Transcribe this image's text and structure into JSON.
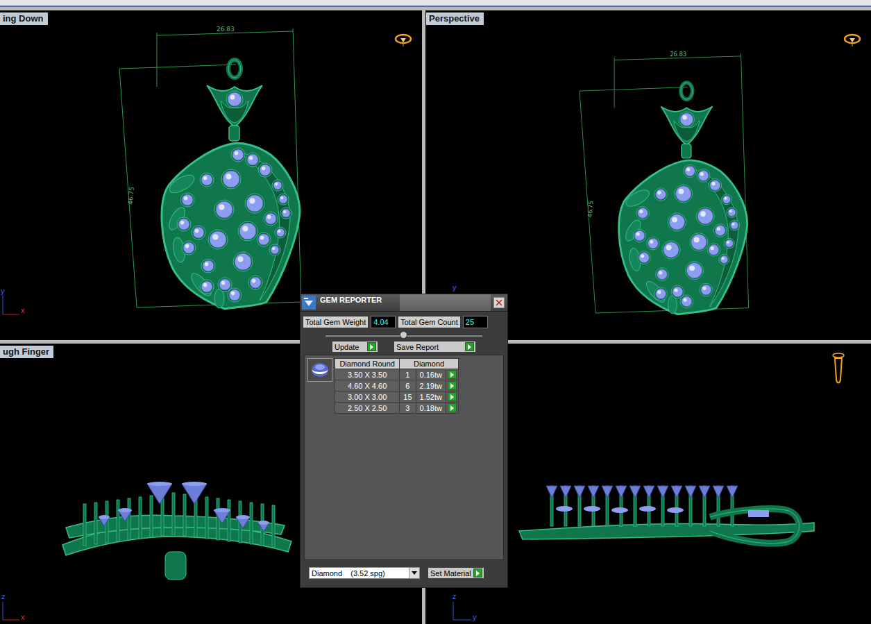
{
  "viewports": [
    {
      "label": "ing Down",
      "dimension_width": "26.83",
      "dimension_height": "46.75",
      "axis_labels": [
        "y",
        "x"
      ]
    },
    {
      "label": "Perspective",
      "dimension_width": "26.83",
      "dimension_height": "46.75",
      "axis_labels": [
        "y"
      ]
    },
    {
      "label": "ugh Finger",
      "axis_labels": [
        "z",
        "x"
      ]
    },
    {
      "label": "",
      "axis_labels": [
        "z",
        "y"
      ]
    }
  ],
  "gem_reporter": {
    "title": "GEM REPORTER",
    "total_weight": {
      "label": "Total Gem Weight",
      "value": "4.04"
    },
    "total_count": {
      "label": "Total Gem Count",
      "value": "25"
    },
    "slider": {
      "level": 0.5
    },
    "buttons": [
      "Update",
      "Save Report"
    ],
    "table": {
      "columns": [
        "Diamond Round",
        "Diamond"
      ],
      "rows": [
        [
          "3.50 X 3.50",
          "1",
          "0.16tw"
        ],
        [
          "4.60 X 4.60",
          "6",
          "2.19tw"
        ],
        [
          "3.00 X 3.00",
          "15",
          "1.52tw"
        ],
        [
          "2.50 X 2.50",
          "3",
          "0.18tw"
        ]
      ]
    },
    "material": "Diamond    (3.52 spg)",
    "set_material": "Set Material"
  }
}
